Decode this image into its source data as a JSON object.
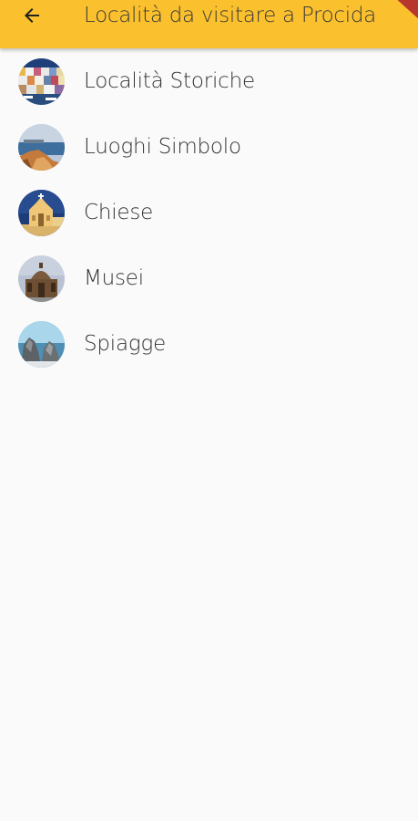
{
  "colors": {
    "appbar": "#fbc02d",
    "background": "#fafafa",
    "text": "#333333",
    "ribbon": "#b8372d"
  },
  "appbar": {
    "back_icon": "arrow-back-icon",
    "title": "Località da visitare a Procida"
  },
  "list": {
    "items": [
      {
        "label": "Località Storiche",
        "thumbnail": "colorful-harbor-houses"
      },
      {
        "label": "Luoghi Simbolo",
        "thumbnail": "cliff-over-sea"
      },
      {
        "label": "Chiese",
        "thumbnail": "yellow-church-facade"
      },
      {
        "label": "Musei",
        "thumbnail": "domed-building"
      },
      {
        "label": "Spiagge",
        "thumbnail": "sea-rocks"
      }
    ]
  }
}
